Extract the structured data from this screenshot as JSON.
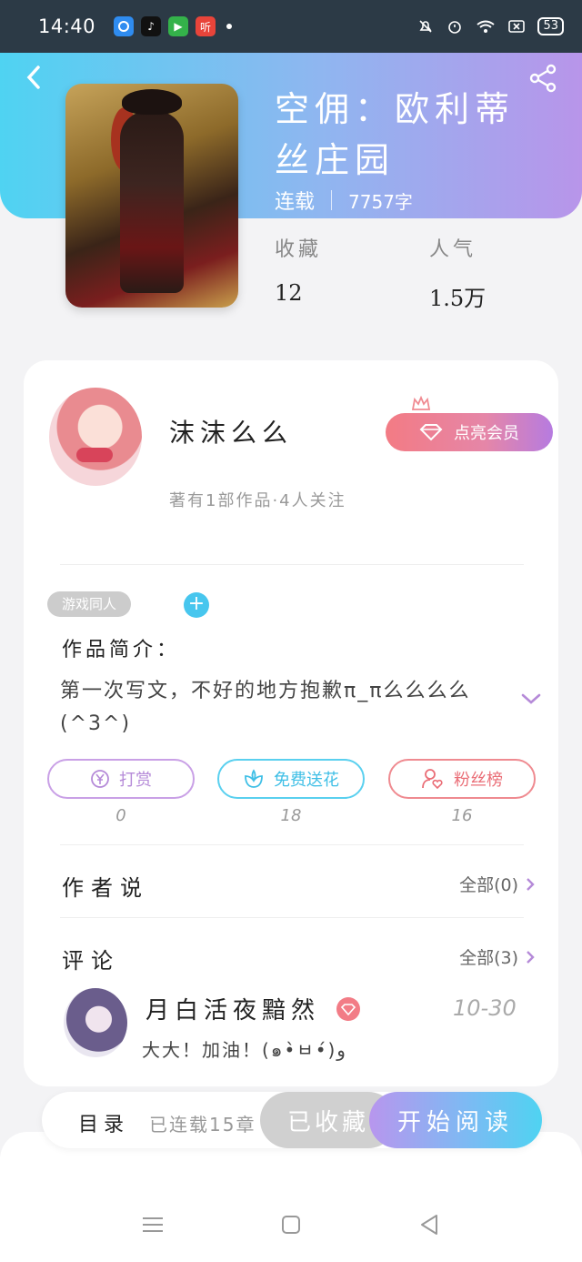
{
  "status_bar": {
    "time": "14:40",
    "apps": [
      {
        "icon": "browser-app-icon",
        "color": "#2f8cf0",
        "text": ""
      },
      {
        "icon": "tiktok-app-icon",
        "color": "#111111",
        "text": "♪"
      },
      {
        "icon": "play-app-icon",
        "color": "#34b24a",
        "text": "▶"
      },
      {
        "icon": "listen-app-icon",
        "color": "#e8443a",
        "text": "听"
      }
    ],
    "battery": "53"
  },
  "book": {
    "title": "空佣：欧利蒂丝庄园",
    "status": "连载",
    "word_count": "7757字",
    "stats": [
      {
        "label": "收藏",
        "value": "12"
      },
      {
        "label": "人气",
        "value": "1.5万"
      }
    ]
  },
  "author": {
    "name": "沫沫么么",
    "sub": "著有1部作品·4人关注",
    "vip_label": "点亮会员"
  },
  "intro": {
    "tag": "游戏同人",
    "add_tag": "+",
    "label": "作品简介：",
    "text": "第一次写文，不好的地方抱歉π_π么么么么(^3^)"
  },
  "actions": [
    {
      "label": "打赏",
      "count": "0"
    },
    {
      "label": "免费送花",
      "count": "18"
    },
    {
      "label": "粉丝榜",
      "count": "16"
    }
  ],
  "author_says": {
    "label": "作者说",
    "all": "全部(0)"
  },
  "comments": {
    "label": "评论",
    "all": "全部(3)",
    "first": {
      "name": "月白活夜黯然",
      "date": "10-30",
      "text": "大大！加油！(๑•̀ㅂ•́)و"
    }
  },
  "bottom": {
    "toc": "目录",
    "toc_sub": "已连载15章",
    "collected": "已收藏",
    "read": "开始阅读"
  },
  "colors": {
    "header_start": "#4fd3f2",
    "header_end": "#b895ea",
    "vip": "#f37b84",
    "accent_purple": "#b58ad8"
  }
}
